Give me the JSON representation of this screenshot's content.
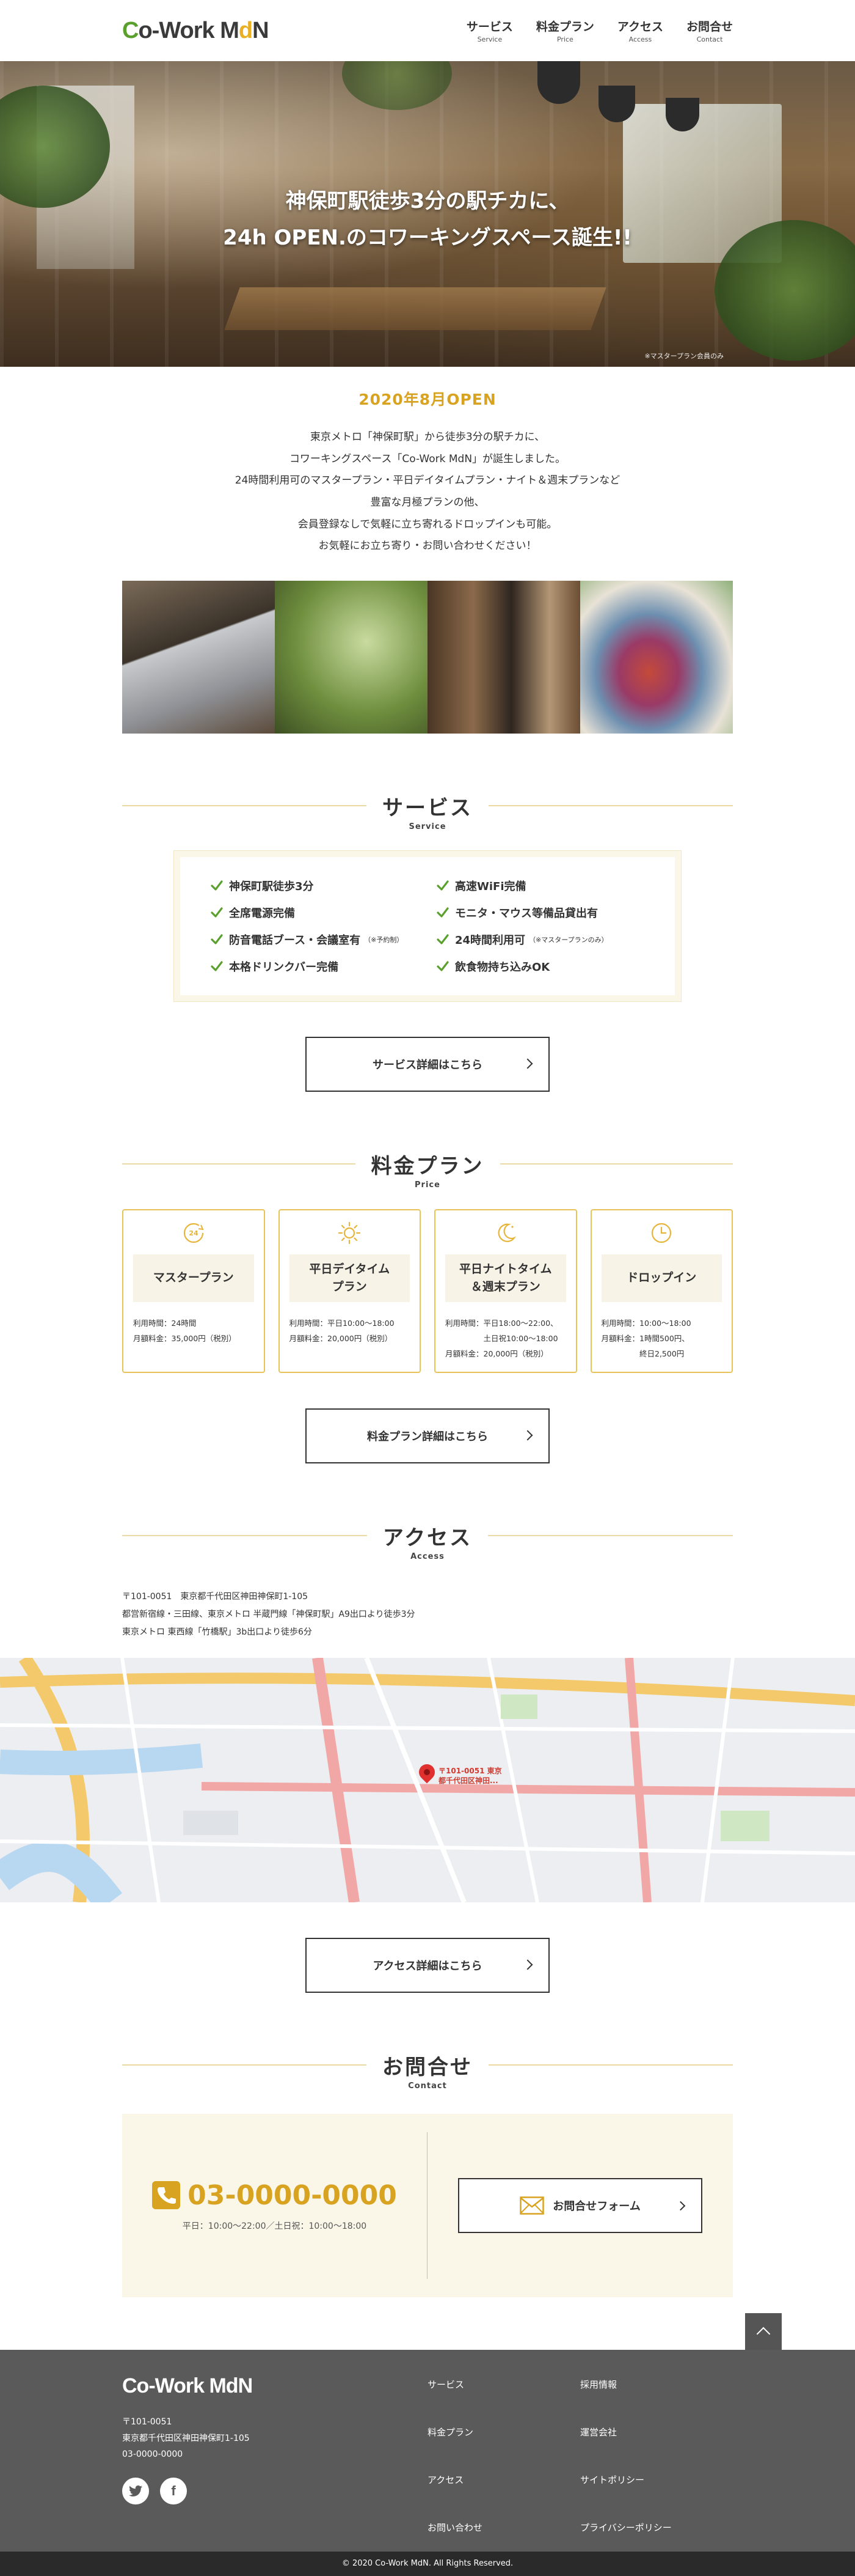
{
  "header": {
    "logo": {
      "part1": "Co-Work M",
      "part2": "d",
      "part3": "N"
    },
    "nav": [
      {
        "jp": "サービス",
        "en": "Service"
      },
      {
        "jp": "料金プラン",
        "en": "Price"
      },
      {
        "jp": "アクセス",
        "en": "Access"
      },
      {
        "jp": "お問合せ",
        "en": "Contact"
      }
    ]
  },
  "hero": {
    "line1": "神保町駅徒歩3分の駅チカに、",
    "line2": "24h OPEN.のコワーキングスペース誕生!!",
    "note": "※マスタープラン会員のみ"
  },
  "intro": {
    "title": "2020年8月OPEN",
    "lines": [
      "東京メトロ「神保町駅」から徒歩3分の駅チカに、",
      "コワーキングスペース「Co-Work MdN」が誕生しました。",
      "24時間利用可のマスタープラン・平日デイタイムプラン・ナイト＆週末プランなど",
      "豊富な月極プランの他、",
      "会員登録なしで気軽に立ち寄れるドロップインも可能。",
      "お気軽にお立ち寄り・お問い合わせください！"
    ]
  },
  "service": {
    "heading": "サービス",
    "heading_en": "Service",
    "items": [
      {
        "text": "神保町駅徒歩3分",
        "note": ""
      },
      {
        "text": "高速WiFi完備",
        "note": ""
      },
      {
        "text": "全席電源完備",
        "note": ""
      },
      {
        "text": "モニタ・マウス等備品貸出有",
        "note": ""
      },
      {
        "text": "防音電話ブース・会議室有",
        "note": "（※予約制）"
      },
      {
        "text": "24時間利用可",
        "note": "（※マスタープランのみ）"
      },
      {
        "text": "本格ドリンクバー完備",
        "note": ""
      },
      {
        "text": "飲食物持ち込みOK",
        "note": ""
      }
    ],
    "button": "サービス詳細はこちら"
  },
  "price": {
    "heading": "料金プラン",
    "heading_en": "Price",
    "plans": [
      {
        "icon": "24h-icon",
        "name1": "マスタープラン",
        "name2": "",
        "detail": "利用時間：24時間\n月額料金：35,000円（税別）"
      },
      {
        "icon": "sun-icon",
        "name1": "平日デイタイム",
        "name2": "プラン",
        "detail": "利用時間：平日10:00〜18:00\n月額料金：20,000円（税別）"
      },
      {
        "icon": "moon-icon",
        "name1": "平日ナイトタイム",
        "name2": "＆週末プラン",
        "detail": "利用時間：平日18:00〜22:00、\n　　　　　土日祝10:00〜18:00\n月額料金：20,000円（税別）"
      },
      {
        "icon": "clock-icon",
        "name1": "ドロップイン",
        "name2": "",
        "detail": "利用時間：10:00〜18:00\n月額料金：1時間500円、\n　　　　　終日2,500円"
      }
    ],
    "button": "料金プラン詳細はこちら"
  },
  "access": {
    "heading": "アクセス",
    "heading_en": "Access",
    "lines": [
      "〒101-0051　東京都千代田区神田神保町1-105",
      "都営新宿線・三田線、東京メトロ 半蔵門線「神保町駅」A9出口より徒歩3分",
      "東京メトロ 東西線「竹橋駅」3b出口より徒歩6分"
    ],
    "map_pin_label1": "〒101-0051 東京",
    "map_pin_label2": "都千代田区神田...",
    "button": "アクセス詳細はこちら"
  },
  "contact": {
    "heading": "お問合せ",
    "heading_en": "Contact",
    "tel": "03-0000-0000",
    "hours": "平日：10:00〜22:00／土日祝：10:00〜18:00",
    "form_button": "お問合せフォーム"
  },
  "footer": {
    "logo": "Co-Work MdN",
    "postal": "〒101-0051",
    "address": "東京都千代田区神田神保町1-105",
    "tel": "03-0000-0000",
    "links": [
      "サービス",
      "採用情報",
      "料金プラン",
      "運営会社",
      "アクセス",
      "サイトポリシー",
      "お問い合わせ",
      "プライバシーポリシー"
    ],
    "copyright": "© 2020 Co-Work MdN. All Rights Reserved."
  },
  "colors": {
    "accent": "#d9a322",
    "green": "#5aa02c",
    "footer_bg": "#5a5a5a"
  }
}
